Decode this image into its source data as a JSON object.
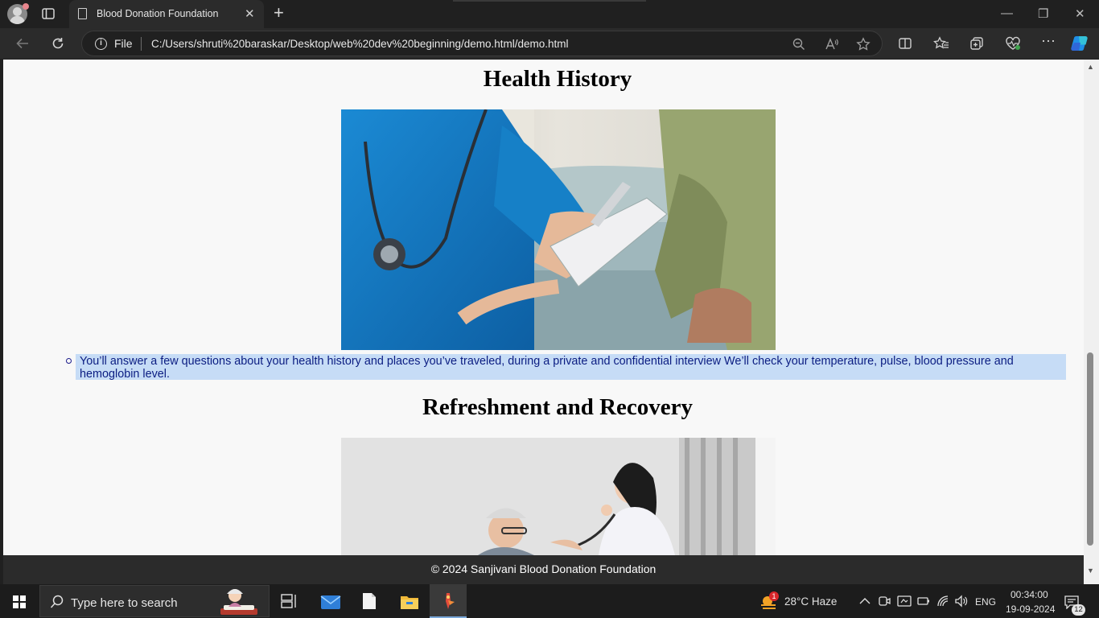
{
  "browser": {
    "tab_title": "Blood Donation Foundation",
    "new_tab": "+",
    "tab_close": "✕",
    "file_label": "File",
    "url": "C:/Users/shruti%20baraskar/Desktop/web%20dev%20beginning/demo.html/demo.html",
    "window_controls": [
      "—",
      "❐",
      "✕"
    ]
  },
  "page": {
    "sections": [
      {
        "heading": "Health History"
      },
      {
        "heading": "Refreshment and Recovery"
      }
    ],
    "list_item": "You’ll answer a few questions about your health history and places you’ve traveled, during a private and confidential interview We’ll check your temperature, pulse, blood pressure and hemoglobin level.",
    "footer": "© 2024 Sanjivani Blood Donation Foundation"
  },
  "taskbar": {
    "search_placeholder": "Type here to search",
    "weather_badge": "1",
    "weather": "28°C  Haze",
    "language": "ENG",
    "time": "00:34:00",
    "date": "19-09-2024",
    "notification_count": "12"
  },
  "colors": {
    "browser_bg": "#202020",
    "page_bg": "#f8f8f8",
    "highlight": "#c6dcf6",
    "link_text": "#0b1d82",
    "footer_bg": "#2b2b2b"
  }
}
